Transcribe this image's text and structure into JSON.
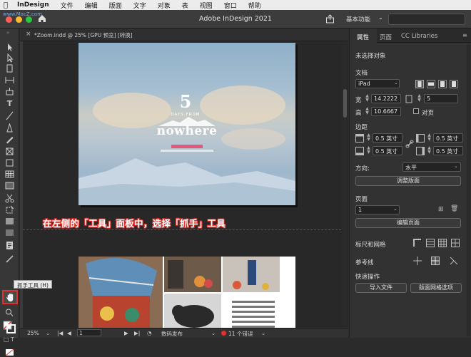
{
  "menubar": {
    "app": "InDesign",
    "items": [
      "文件",
      "编辑",
      "版面",
      "文字",
      "对象",
      "表",
      "视图",
      "窗口",
      "帮助"
    ],
    "watermark": "www.MacZ.com"
  },
  "window": {
    "title": "Adobe InDesign 2021",
    "workspace": "基本功能"
  },
  "document": {
    "tab_title": "*Zoom.indd @ 25% [GPU 预览] [转换]"
  },
  "page1": {
    "number": "5",
    "days_from": "DAYS FROM",
    "title": "nowhere"
  },
  "annotation": {
    "text": "在左侧的「工具」面板中，选择「抓手」工具"
  },
  "tooltip": {
    "text": "抓手工具 (H)"
  },
  "status": {
    "zoom": "25%",
    "page": "1",
    "preflight": "数码发布",
    "errors": "11 个错误"
  },
  "panel": {
    "tabs": [
      "属性",
      "页面",
      "CC Libraries"
    ],
    "no_selection": "未选择对象",
    "document_label": "文档",
    "preset": "iPad",
    "width_label": "宽",
    "width": "14.2222",
    "height_label": "高",
    "height": "10.6667",
    "pages": "5",
    "facing_pages": "对页",
    "margins_label": "边距",
    "margin_top": "0.5 英寸",
    "margin_bottom": "0.5 英寸",
    "margin_left": "0.5 英寸",
    "margin_right": "0.5 英寸",
    "orientation_label": "方向:",
    "orientation": "水平",
    "adjust_layout": "调整版面",
    "page_section": "页面",
    "page_value": "1",
    "edit_page": "编辑页面",
    "rulers_grids": "标尺和网格",
    "guides": "参考线",
    "quick_actions": "快速操作",
    "import_file": "导入文件",
    "layout_options": "版面网格选项"
  },
  "colors": {
    "annotation_red": "#e0322c",
    "traffic_red": "#fe5f57",
    "traffic_yellow": "#febc2e",
    "traffic_green": "#28c840"
  }
}
